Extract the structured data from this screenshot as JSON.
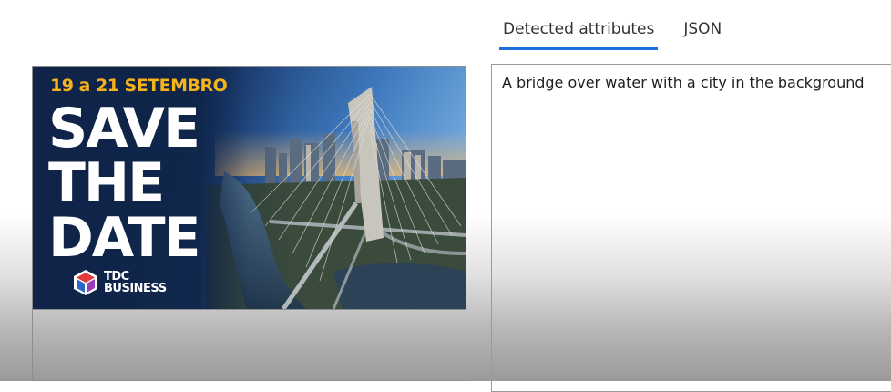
{
  "tabs": {
    "detected_label": "Detected attributes",
    "json_label": "JSON",
    "active": "Detected attributes"
  },
  "banner": {
    "date_text": "19 a 21 SETEMBRO",
    "headline_1": "SAVE",
    "headline_2": "THE",
    "headline_3": "DATE",
    "logo_line_1": "TDC",
    "logo_line_2": "BUSINESS"
  },
  "attributes": {
    "caption": "A bridge over water with a city in the background"
  },
  "colors": {
    "accent": "#1e6fd9",
    "banner_yellow": "#f4b21d",
    "banner_navy": "#0f2448"
  }
}
